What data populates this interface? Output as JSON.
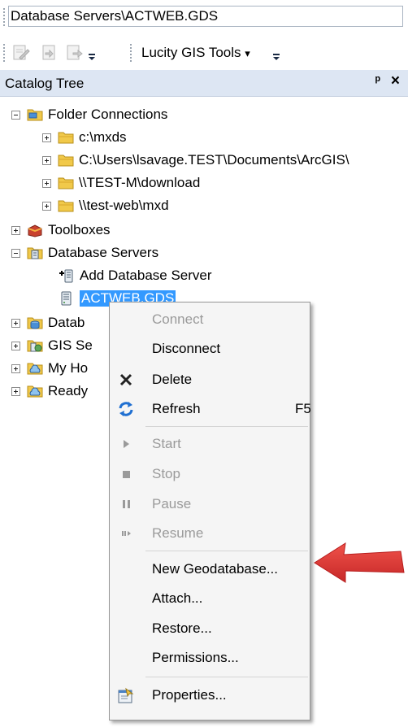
{
  "location_bar": {
    "value": "Database Servers\\ACTWEB.GDS"
  },
  "toolbar": {
    "lucity_label": "Lucity GIS Tools",
    "lucity_caret": "▾"
  },
  "catalog": {
    "title": "Catalog Tree",
    "pin_glyph": "ᵖ",
    "close_glyph": "×"
  },
  "tree": {
    "folder_connections": "Folder Connections",
    "folders": [
      "c:\\mxds",
      "C:\\Users\\lsavage.TEST\\Documents\\ArcGIS\\",
      "\\\\TEST-M\\download",
      "\\\\test-web\\mxd"
    ],
    "toolboxes": "Toolboxes",
    "database_servers": "Database Servers",
    "add_database_server": "Add Database Server",
    "actweb": "ACTWEB.GDS",
    "database_connections_partial": "Datab",
    "gis_servers_partial": "GIS Se",
    "my_hosted_partial": "My Ho",
    "ready_partial": "Ready"
  },
  "context_menu": {
    "items": [
      {
        "label": "Connect",
        "enabled": false
      },
      {
        "label": "Disconnect",
        "enabled": true
      },
      {
        "label": "Delete",
        "enabled": true
      },
      {
        "label": "Refresh",
        "enabled": true,
        "shortcut": "F5"
      },
      {
        "label": "Start",
        "enabled": false
      },
      {
        "label": "Stop",
        "enabled": false
      },
      {
        "label": "Pause",
        "enabled": false
      },
      {
        "label": "Resume",
        "enabled": false
      },
      {
        "label": "New Geodatabase...",
        "enabled": true
      },
      {
        "label": "Attach...",
        "enabled": true
      },
      {
        "label": "Restore...",
        "enabled": true
      },
      {
        "label": "Permissions...",
        "enabled": true
      },
      {
        "label": "Properties...",
        "enabled": true
      }
    ]
  },
  "colors": {
    "selection": "#3399ff",
    "header_bg": "#dde6f3",
    "arrow": "#e53935"
  }
}
